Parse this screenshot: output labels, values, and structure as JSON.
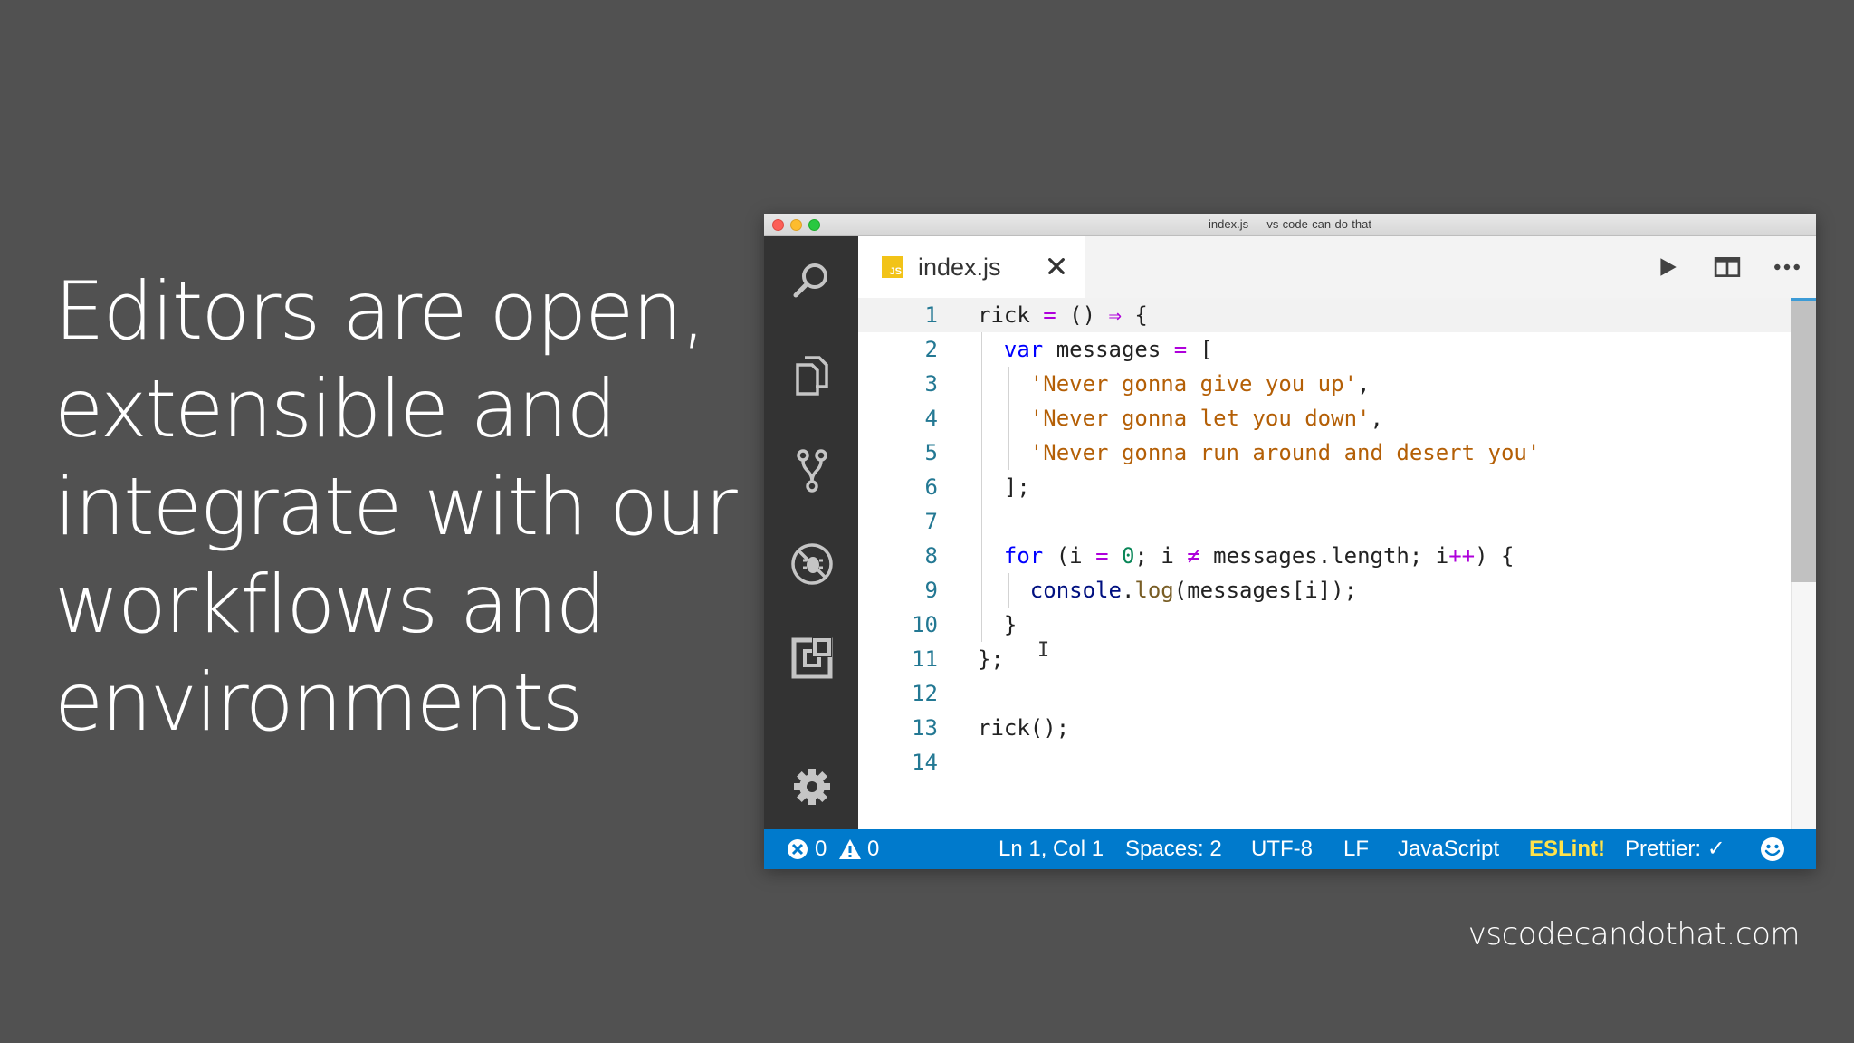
{
  "slide": {
    "heading_lines": [
      "Editors are open,",
      "extensible and",
      "integrate with our",
      "workflows and",
      "environments"
    ],
    "footer_url": "vscodecandothat.com"
  },
  "window": {
    "title": "index.js — vs-code-can-do-that"
  },
  "activity_bar": {
    "icons": [
      "search-icon",
      "explorer-icon",
      "source-control-icon",
      "debug-icon",
      "extensions-icon",
      "settings-gear-icon"
    ]
  },
  "tab": {
    "badge": "JS",
    "label": "index.js",
    "close_glyph": "✕"
  },
  "editor_actions": [
    "run-icon",
    "split-editor-icon",
    "more-actions-icon"
  ],
  "editor": {
    "line_numbers": [
      "1",
      "2",
      "3",
      "4",
      "5",
      "6",
      "7",
      "8",
      "9",
      "10",
      "11",
      "12",
      "13",
      "14"
    ],
    "code": [
      [
        {
          "t": "rick ",
          "c": "txt"
        },
        {
          "t": "=",
          "c": "op"
        },
        {
          "t": " () ",
          "c": "txt"
        },
        {
          "t": "⇒",
          "c": "op"
        },
        {
          "t": " {",
          "c": "txt"
        }
      ],
      [
        {
          "t": "  ",
          "c": "txt"
        },
        {
          "t": "var",
          "c": "kw"
        },
        {
          "t": " messages ",
          "c": "txt"
        },
        {
          "t": "=",
          "c": "op"
        },
        {
          "t": " [",
          "c": "txt"
        }
      ],
      [
        {
          "t": "    ",
          "c": "txt"
        },
        {
          "t": "'Never gonna give you up'",
          "c": "str2"
        },
        {
          "t": ",",
          "c": "txt"
        }
      ],
      [
        {
          "t": "    ",
          "c": "txt"
        },
        {
          "t": "'Never gonna let you down'",
          "c": "str2"
        },
        {
          "t": ",",
          "c": "txt"
        }
      ],
      [
        {
          "t": "    ",
          "c": "txt"
        },
        {
          "t": "'Never gonna run around and desert you'",
          "c": "str2"
        }
      ],
      [
        {
          "t": "  ];",
          "c": "txt"
        }
      ],
      [
        {
          "t": "",
          "c": "txt"
        }
      ],
      [
        {
          "t": "  ",
          "c": "txt"
        },
        {
          "t": "for",
          "c": "kw"
        },
        {
          "t": " (i ",
          "c": "txt"
        },
        {
          "t": "=",
          "c": "op"
        },
        {
          "t": " ",
          "c": "txt"
        },
        {
          "t": "0",
          "c": "num"
        },
        {
          "t": "; i ",
          "c": "txt"
        },
        {
          "t": "≠",
          "c": "op"
        },
        {
          "t": " messages.length; i",
          "c": "txt"
        },
        {
          "t": "++",
          "c": "op"
        },
        {
          "t": ") {",
          "c": "txt"
        }
      ],
      [
        {
          "t": "    ",
          "c": "txt"
        },
        {
          "t": "console",
          "c": "prop"
        },
        {
          "t": ".",
          "c": "txt"
        },
        {
          "t": "log",
          "c": "fn"
        },
        {
          "t": "(messages[i]);",
          "c": "txt"
        }
      ],
      [
        {
          "t": "  }",
          "c": "txt"
        }
      ],
      [
        {
          "t": "};",
          "c": "txt"
        }
      ],
      [
        {
          "t": "",
          "c": "txt"
        }
      ],
      [
        {
          "t": "rick();",
          "c": "txt"
        }
      ],
      [
        {
          "t": "",
          "c": "txt"
        }
      ]
    ],
    "cursor_glyph": "I"
  },
  "statusbar": {
    "errors": "0",
    "warnings": "0",
    "position": "Ln 1, Col 1",
    "spaces": "Spaces: 2",
    "encoding": "UTF-8",
    "eol": "LF",
    "language": "JavaScript",
    "eslint": "ESLint!",
    "prettier": "Prettier: ✓",
    "feedback_icon": "smiley-icon"
  },
  "colors": {
    "slide_bg": "#515151",
    "statusbar_bg": "#007acc",
    "activitybar_bg": "#333333",
    "eslint_warning": "#ffe24a",
    "js_badge": "#f2c318"
  }
}
